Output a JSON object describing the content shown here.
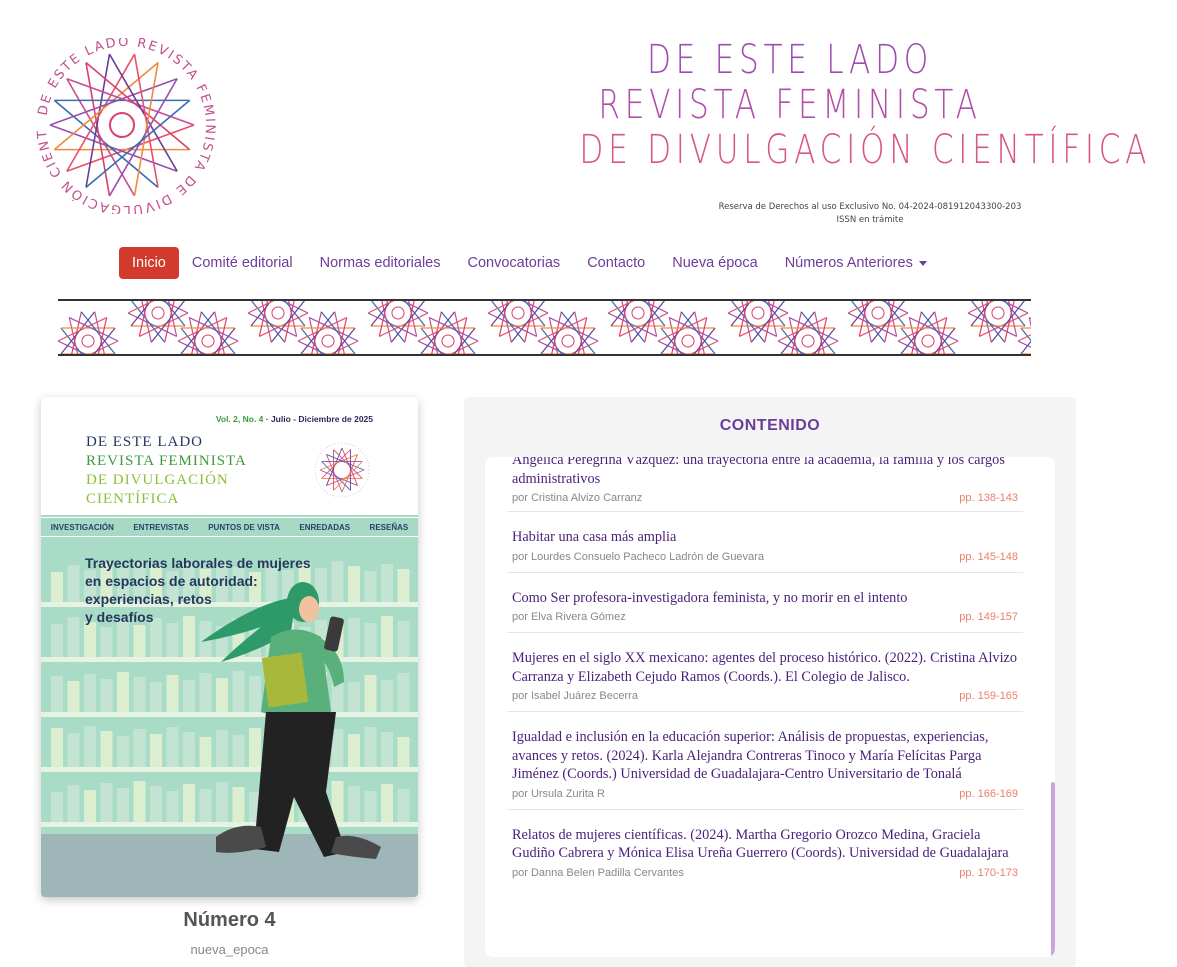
{
  "header": {
    "logo_ring_text": "DE ESTE LADO REVISTA FEMINISTA DE DIVULGACIÓN CIENTÍFICA",
    "title_lines": [
      "DE ESTE LADO",
      "REVISTA FEMINISTA",
      "DE DIVULGACIÓN CIENTÍFICA"
    ],
    "reserva": "Reserva de Derechos al uso Exclusivo No. 04-2024-081912043300-203",
    "issn": "ISSN en trámite"
  },
  "nav": {
    "items": [
      "Inicio",
      "Comité editorial",
      "Normas editoriales",
      "Convocatorias",
      "Contacto",
      "Nueva época",
      "Números Anteriores"
    ]
  },
  "cover": {
    "vol": "Vol. 2, No. 4",
    "dates": "· Julio - Diciembre de 2025",
    "title_lines": [
      "DE ESTE LADO",
      "REVISTA FEMINISTA",
      "DE DIVULGACIÓN",
      "CIENTÍFICA"
    ],
    "tabs": [
      "INVESTIGACIÓN",
      "ENTREVISTAS",
      "PUNTOS DE VISTA",
      "ENREDADAS",
      "RESEÑAS"
    ],
    "headline_lines": [
      "Trayectorias laborales de mujeres",
      "en espacios de autoridad:",
      "experiencias, retos",
      "y desafíos"
    ]
  },
  "issue": {
    "title": "Número 4",
    "subtitle": "nueva_epoca"
  },
  "content": {
    "heading": "CONTENIDO",
    "items": [
      {
        "title": "Angélica Peregrina Vázquez: una trayectoria entre la academia, la familia y los cargos administrativos",
        "author": "por Cristina Alvizo Carranz",
        "pages": "pp. 138-143"
      },
      {
        "title": "Habitar una casa más amplia",
        "author": "por Lourdes Consuelo Pacheco Ladrón de Guevara",
        "pages": "pp. 145-148"
      },
      {
        "title": "Como Ser profesora-investigadora feminista, y no morir en el intento",
        "author": "por Elva Rivera Gómez",
        "pages": "pp. 149-157"
      },
      {
        "title": "Mujeres en el siglo XX mexicano: agentes del proceso histórico. (2022). Cristina Alvizo Carranza y Elizabeth Cejudo Ramos (Coords.). El Colegio de Jalisco.",
        "author": "por Isabel Juárez Becerra",
        "pages": "pp. 159-165"
      },
      {
        "title": "Igualdad e inclusión en la educación superior: Análisis de propuestas, experiencias, avances y retos. (2024). Karla Alejandra Contreras Tinoco y María Felícitas Parga Jiménez (Coords.) Universidad de Guadalajara-Centro Universitario de Tonalá",
        "author": "por Ursula Zurita R",
        "pages": "pp. 166-169"
      },
      {
        "title": "Relatos de mujeres científicas. (2024). Martha Gregorio Orozco Medina, Graciela Gudiño Cabrera y Mónica Elisa Ureña Guerrero (Coords). Universidad de Guadalajara",
        "author": "por Danna Belen Padilla Cervantes",
        "pages": "pp. 170-173"
      }
    ]
  },
  "colors": {
    "accent_purple": "#6a3d9a",
    "active_red": "#d13a2c",
    "pages_salmon": "#e8806a",
    "title_pink": "#c54f93"
  }
}
